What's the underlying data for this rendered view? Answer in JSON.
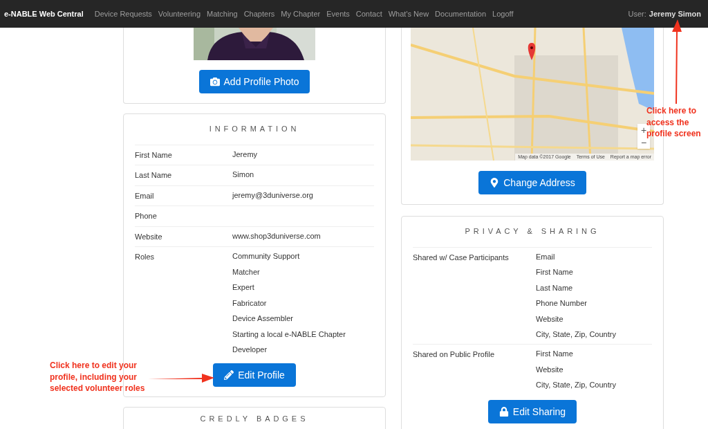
{
  "navbar": {
    "brand": "e-NABLE Web Central",
    "links": [
      "Device Requests",
      "Volunteering",
      "Matching",
      "Chapters",
      "My Chapter",
      "Events",
      "Contact",
      "What's New",
      "Documentation",
      "Logoff"
    ],
    "user_label": "User:",
    "user_name": "Jeremy Simon"
  },
  "photo_card": {
    "button": "Add Profile Photo"
  },
  "information": {
    "title": "INFORMATION",
    "rows": [
      {
        "label": "First Name",
        "values": [
          "Jeremy"
        ]
      },
      {
        "label": "Last Name",
        "values": [
          "Simon"
        ]
      },
      {
        "label": "Email",
        "values": [
          "jeremy@3duniverse.org"
        ]
      },
      {
        "label": "Phone",
        "values": []
      },
      {
        "label": "Website",
        "values": [
          "www.shop3duniverse.com"
        ]
      },
      {
        "label": "Roles",
        "values": [
          "Community Support",
          "Matcher",
          "Expert",
          "Fabricator",
          "Device Assembler",
          "Starting a local e-NABLE Chapter",
          "Developer"
        ]
      }
    ],
    "button": "Edit Profile"
  },
  "credly": {
    "title": "CREDLY BADGES"
  },
  "map_card": {
    "zoom_in": "+",
    "zoom_out": "−",
    "attribution": [
      "Map data ©2017 Google",
      "Terms of Use",
      "Report a map error"
    ],
    "button": "Change Address"
  },
  "privacy": {
    "title": "PRIVACY & SHARING",
    "rows": [
      {
        "label": "Shared w/ Case Participants",
        "values": [
          "Email",
          "First Name",
          "Last Name",
          "Phone Number",
          "Website",
          "City, State, Zip, Country"
        ]
      },
      {
        "label": "Shared on Public Profile",
        "values": [
          "First Name",
          "Website",
          "City, State, Zip, Country"
        ]
      }
    ],
    "button": "Edit Sharing"
  },
  "annotations": [
    {
      "text": "Click here to edit your profile, including your selected volunteer roles"
    },
    {
      "text": "Click here to access the profile screen"
    }
  ]
}
